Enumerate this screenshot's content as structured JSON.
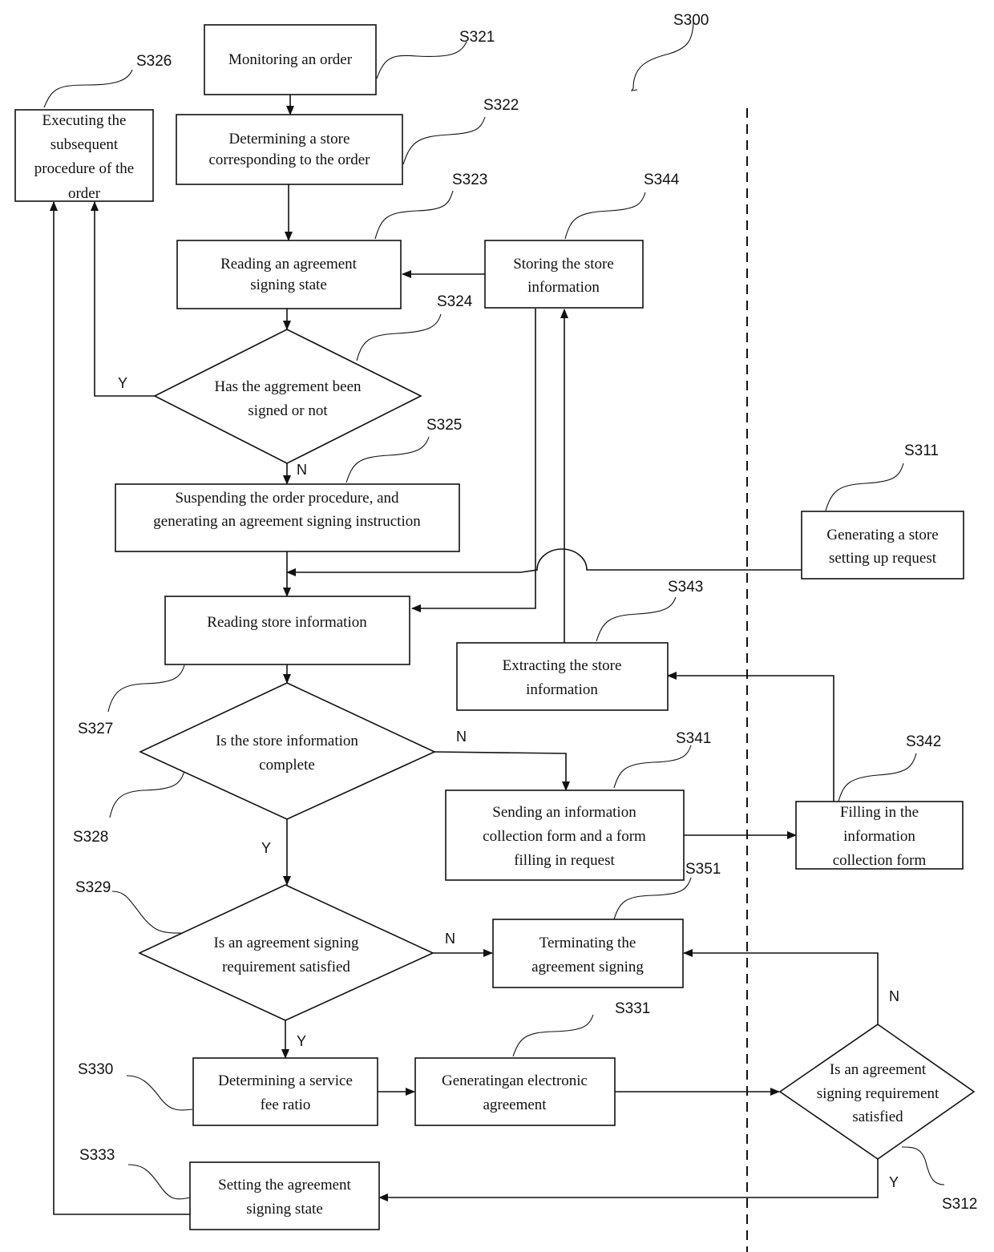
{
  "diagram": {
    "title_ref": "S300",
    "nodes": {
      "s321": {
        "ref": "S321",
        "lines": [
          "Monitoring an order"
        ]
      },
      "s322": {
        "ref": "S322",
        "lines": [
          "Determining a store",
          "corresponding to the order"
        ]
      },
      "s323": {
        "ref": "S323",
        "lines": [
          "Reading an agreement",
          "signing state"
        ]
      },
      "s324": {
        "ref": "S324",
        "lines": [
          "Has the aggrement been",
          "signed or not"
        ]
      },
      "s325": {
        "ref": "S325",
        "lines": [
          "Suspending the order procedure, and",
          "generating an agreement signing instruction"
        ]
      },
      "s326": {
        "ref": "S326",
        "lines": [
          "Executing the",
          "subsequent",
          "procedure of the",
          "order"
        ]
      },
      "s327": {
        "ref": "S327",
        "lines": [
          "Reading store information"
        ]
      },
      "s328": {
        "ref": "S328",
        "lines": [
          "Is the store information",
          "complete"
        ]
      },
      "s329": {
        "ref": "S329",
        "lines": [
          "Is an agreement signing",
          "requirement satisfied"
        ]
      },
      "s330": {
        "ref": "S330",
        "lines": [
          "Determining a service",
          "fee ratio"
        ]
      },
      "s331": {
        "ref": "S331",
        "lines": [
          "Generatingan electronic",
          "agreement"
        ]
      },
      "s333": {
        "ref": "S333",
        "lines": [
          "Setting the agreement",
          "signing state"
        ]
      },
      "s341": {
        "ref": "S341",
        "lines": [
          "Sending an information",
          "collection form and a form",
          "filling in request"
        ]
      },
      "s342": {
        "ref": "S342",
        "lines": [
          "Filling in the",
          "information",
          "collection form"
        ]
      },
      "s343": {
        "ref": "S343",
        "lines": [
          "Extracting the store",
          "information"
        ]
      },
      "s344": {
        "ref": "S344",
        "lines": [
          "Storing the store",
          "information"
        ]
      },
      "s351": {
        "ref": "S351",
        "lines": [
          "Terminating the",
          "agreement signing"
        ]
      },
      "s311": {
        "ref": "S311",
        "lines": [
          "Generating a store",
          "setting up request"
        ]
      },
      "s312": {
        "ref": "S312",
        "lines": [
          "Is an agreement",
          "signing requirement",
          "satisfied"
        ]
      }
    },
    "branch_labels": {
      "yes": "Y",
      "no": "N"
    }
  }
}
